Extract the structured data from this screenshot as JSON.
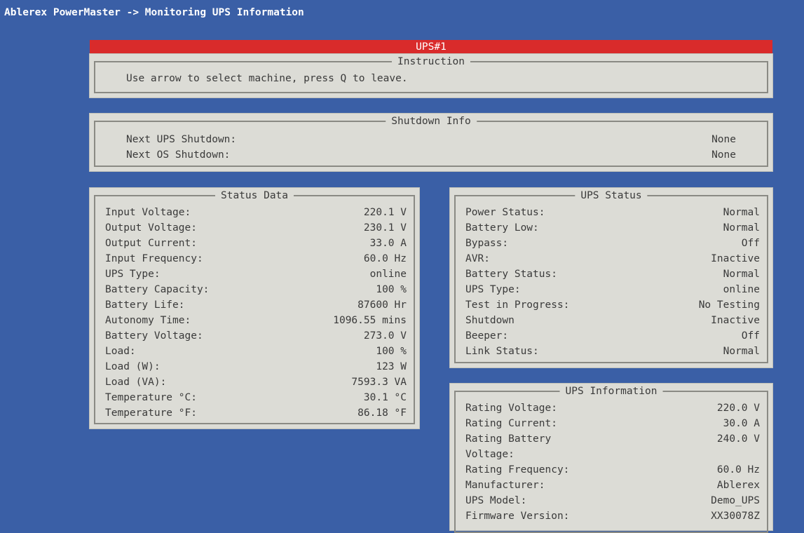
{
  "window_title": "Ablerex PowerMaster -> Monitoring UPS Information",
  "ups_header": "UPS#1",
  "instruction": {
    "title": "Instruction",
    "text": "Use arrow to select machine, press Q to leave."
  },
  "shutdown_info": {
    "title": "Shutdown Info",
    "rows": [
      {
        "label": "Next UPS Shutdown:",
        "value": "None"
      },
      {
        "label": "Next OS Shutdown:",
        "value": "None"
      }
    ]
  },
  "status_data": {
    "title": "Status Data",
    "rows": [
      {
        "label": "Input Voltage:",
        "value": "220.1 V"
      },
      {
        "label": "Output Voltage:",
        "value": "230.1 V"
      },
      {
        "label": "Output Current:",
        "value": "33.0 A"
      },
      {
        "label": "Input Frequency:",
        "value": "60.0 Hz"
      },
      {
        "label": "UPS Type:",
        "value": "online"
      },
      {
        "label": "Battery Capacity:",
        "value": "100 %"
      },
      {
        "label": "Battery Life:",
        "value": "87600 Hr"
      },
      {
        "label": "Autonomy Time:",
        "value": "1096.55 mins"
      },
      {
        "label": "Battery Voltage:",
        "value": "273.0 V"
      },
      {
        "label": "Load:",
        "value": "100 %"
      },
      {
        "label": "Load (W):",
        "value": "123 W"
      },
      {
        "label": "Load (VA):",
        "value": "7593.3 VA"
      },
      {
        "label": "Temperature °C:",
        "value": "30.1 °C"
      },
      {
        "label": "Temperature °F:",
        "value": "86.18 °F"
      }
    ]
  },
  "ups_status": {
    "title": "UPS Status",
    "rows": [
      {
        "label": "Power Status:",
        "value": "Normal"
      },
      {
        "label": "Battery Low:",
        "value": "Normal"
      },
      {
        "label": "Bypass:",
        "value": "Off"
      },
      {
        "label": "AVR:",
        "value": "Inactive"
      },
      {
        "label": "Battery Status:",
        "value": "Normal"
      },
      {
        "label": "UPS Type:",
        "value": "online"
      },
      {
        "label": "Test in Progress:",
        "value": "No Testing"
      },
      {
        "label": "Shutdown",
        "value": "Inactive"
      },
      {
        "label": "Beeper:",
        "value": "Off"
      },
      {
        "label": "Link Status:",
        "value": "Normal"
      }
    ]
  },
  "ups_information": {
    "title": "UPS Information",
    "rows": [
      {
        "label": "Rating Voltage:",
        "value": "220.0 V"
      },
      {
        "label": "Rating Current:",
        "value": "30.0 A"
      },
      {
        "label": "Rating Battery",
        "value": "240.0 V"
      },
      {
        "label": "Voltage:",
        "value": ""
      },
      {
        "label": "Rating Frequency:",
        "value": "60.0 Hz"
      },
      {
        "label": "Manufacturer:",
        "value": "Ablerex"
      },
      {
        "label": "UPS Model:",
        "value": "Demo_UPS"
      },
      {
        "label": "Firmware Version:",
        "value": "XX30078Z"
      }
    ]
  },
  "colors": {
    "background": "#3a5fa6",
    "panel": "#dcdcd6",
    "header_bar": "#d92b2b",
    "title_text": "#ffffff"
  }
}
